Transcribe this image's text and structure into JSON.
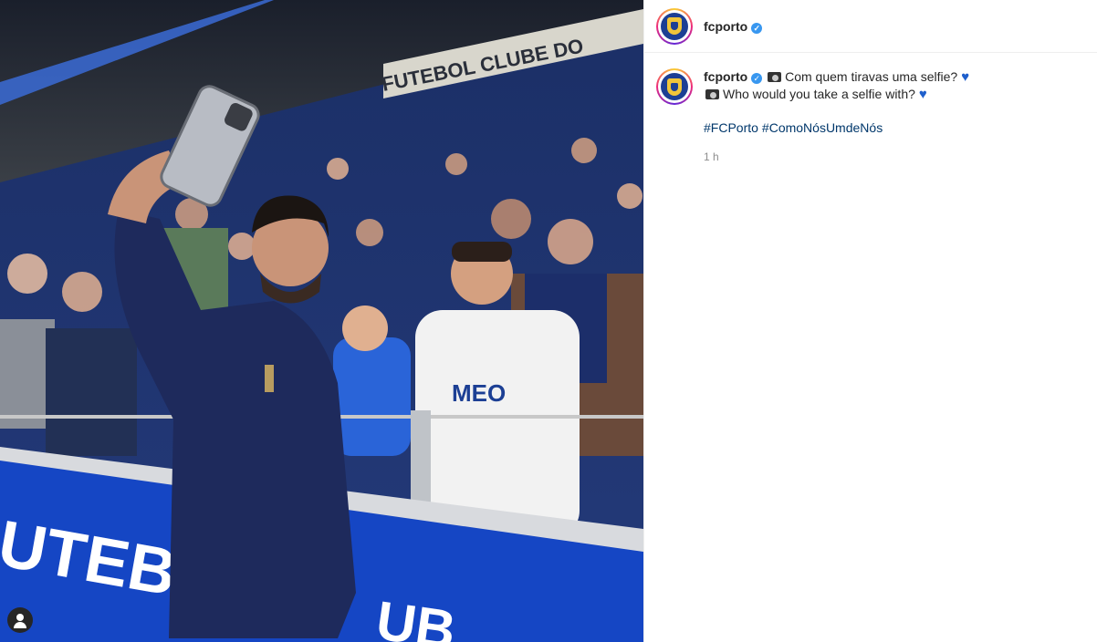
{
  "header": {
    "username": "fcporto",
    "verified_icon": "verified-badge-icon"
  },
  "media": {
    "stadium_sign": "FUTEBOL CLUBE DO",
    "board_text": "UTEBOL",
    "board_text2": "UB",
    "shirt_sponsor": "MEO",
    "colors": {
      "stadium_blue": "#1c3f94",
      "board_blue": "#1546c4",
      "crowd_dark": "#0d1b3a"
    }
  },
  "caption": {
    "username": "fcporto",
    "line1": "Com quem tiravas uma selfie?",
    "line2": "Who would you take a selfie with?",
    "hashtags": [
      "#FCPorto",
      "#ComoNósUmdeNós"
    ],
    "time": "1 h"
  }
}
